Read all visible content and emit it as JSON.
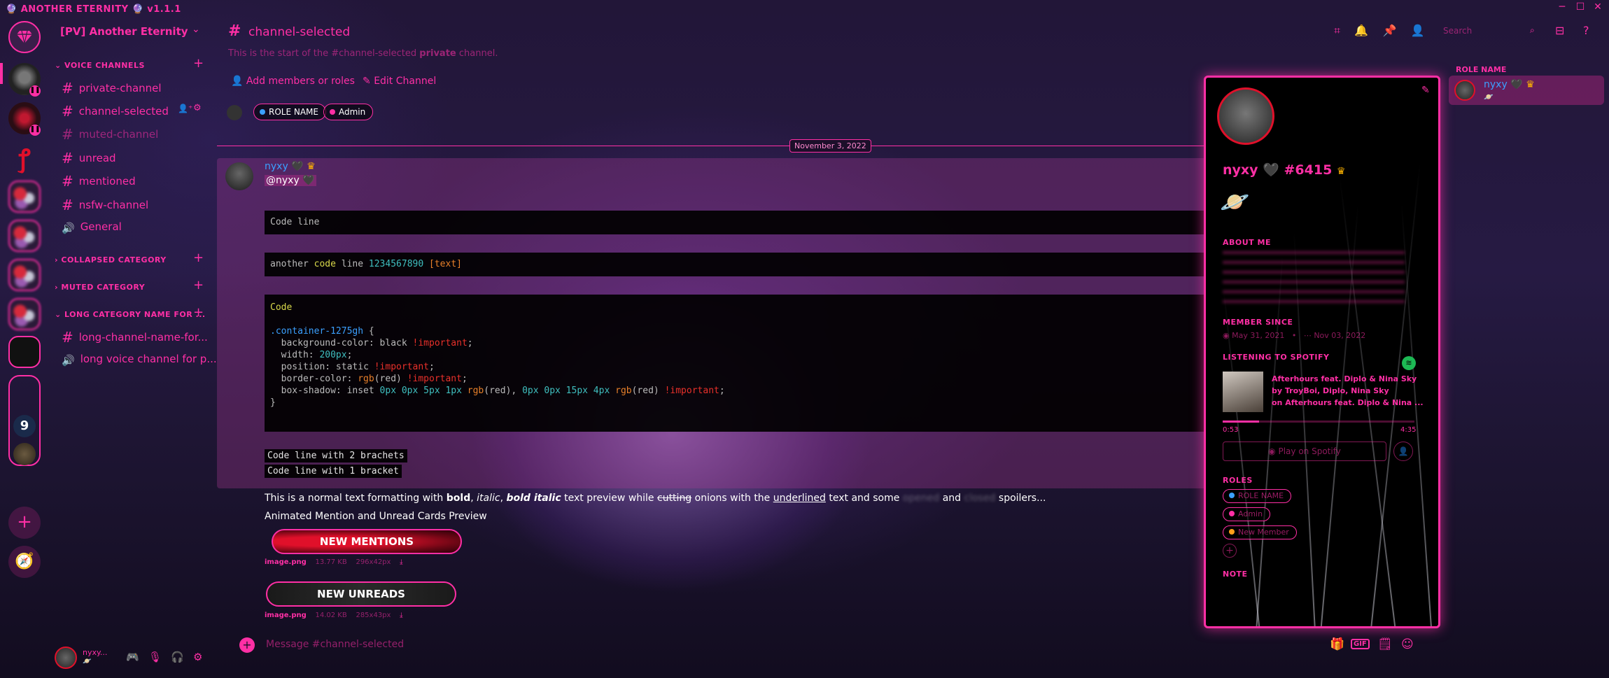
{
  "window": {
    "app_title": "ANOTHER ETERNITY",
    "version": "v1.1.1"
  },
  "server": {
    "name": "[PV] Another Eternity"
  },
  "sidebar": {
    "categories": [
      {
        "label": "VOICE CHANNELS"
      },
      {
        "label": "COLLAPSED CATEGORY"
      },
      {
        "label": "MUTED CATEGORY"
      },
      {
        "label": "LONG CATEGORY NAME FOR ..."
      }
    ],
    "channels": [
      {
        "label": "private-channel",
        "type": "text"
      },
      {
        "label": "channel-selected",
        "type": "text"
      },
      {
        "label": "muted-channel",
        "type": "text"
      },
      {
        "label": "unread",
        "type": "text"
      },
      {
        "label": "mentioned",
        "type": "text"
      },
      {
        "label": "nsfw-channel",
        "type": "text"
      },
      {
        "label": "General",
        "type": "voice"
      },
      {
        "label": "long-channel-name-for...",
        "type": "text"
      },
      {
        "label": "long voice channel for p...",
        "type": "voice"
      }
    ]
  },
  "header": {
    "channel_name": "channel-selected",
    "search_placeholder": "Search"
  },
  "intro": {
    "prefix": "This is the start of the",
    "channel": "#channel-selected",
    "private_word": "private",
    "suffix": "channel.",
    "add_members": "Add members or roles",
    "edit_channel": "Edit Channel",
    "roles": [
      {
        "label": "ROLE NAME",
        "color": "#3ba0ff"
      },
      {
        "label": "Admin",
        "color": "#ff2fa5"
      }
    ]
  },
  "date_divider": "November 3, 2022",
  "message": {
    "author": "nyxy",
    "mention": "@nyxy",
    "code_line": "Code line",
    "code_line_2": {
      "w1": "another",
      "w2": "code",
      "w3": "line",
      "num": "1234567890",
      "br": "[text]"
    },
    "code_block": {
      "lang": "Code",
      "l1_sel": ".container-1275gh",
      "l1_brace": " {",
      "l2_prop": "background-color:",
      "l2_val": " black ",
      "l2_imp": "!important",
      "l2_semi": ";",
      "l3_prop": "width:",
      "l3_val": " 200px",
      "l3_semi": ";",
      "l4_prop": "position:",
      "l4_val": " static ",
      "l4_imp": "!important",
      "l4_semi": ";",
      "l5_prop": "border-color:",
      "l5_fn": " rgb",
      "l5_arg": "(red) ",
      "l5_imp": "!important",
      "l5_semi": ";",
      "l6_prop": "box-shadow:",
      "l6_a": " inset ",
      "l6_b": "0px 0px 5px 1px ",
      "l6_c": "rgb",
      "l6_d": "(red), ",
      "l6_e": "0px 0px 15px 4px ",
      "l6_f": "rgb",
      "l6_g": "(red) ",
      "l6_h": "!important",
      "l6_semi": ";",
      "close": "}"
    },
    "inline_code_1": "Code line with 2 brachets",
    "inline_code_2": "Code line with 1 bracket",
    "text": {
      "t1": "This is a normal text formatting with ",
      "bold": "bold",
      "comma1": ", ",
      "italic": "italic",
      "comma2": ", ",
      "bold_italic": "bold italic",
      "t2": " text preview while ",
      "strike": "cutting",
      "t3": " onions with the ",
      "underline": "underlined",
      "t4": " text and some ",
      "spoiler1": "opened",
      "t5": " and ",
      "spoiler2": "closed",
      "t6": " spoilers..."
    },
    "preview_label": "Animated Mention and Unread Cards Preview",
    "attachments": [
      {
        "banner": "NEW MENTIONS",
        "name": "image.png",
        "size": "13.77 KB",
        "dims": "296x42px"
      },
      {
        "banner": "NEW UNREADS",
        "name": "image.png",
        "size": "14.02 KB",
        "dims": "285x43px"
      }
    ]
  },
  "composer": {
    "placeholder": "Message #channel-selected"
  },
  "user_panel": {
    "name": "nyxy..."
  },
  "profile": {
    "name": "nyxy",
    "discriminator": "#6415",
    "sections": {
      "about": "ABOUT ME",
      "member_since": "MEMBER SINCE",
      "spotify": "LISTENING TO SPOTIFY",
      "roles": "ROLES",
      "note": "NOTE"
    },
    "member_since_discord": "May 31, 2021",
    "member_since_server": "Nov 03, 2022",
    "spotify": {
      "track": "Afterhours feat. Diplo & Nina Sky",
      "artist": "by TroyBoi, Diplo, Nina Sky",
      "album": "on Afterhours feat. Diplo & Nina ...",
      "elapsed": "0:53",
      "duration": "4:35",
      "progress": 0.19,
      "play_label": "Play on Spotify"
    },
    "roles": [
      {
        "label": "ROLE NAME",
        "color": "#3ba0ff"
      },
      {
        "label": "Admin",
        "color": "#ff2fa5"
      },
      {
        "label": "New Member",
        "color": "#ff9f1a"
      }
    ]
  },
  "members": {
    "group_label": "ROLE NAME",
    "items": [
      {
        "name": "nyxy"
      }
    ]
  },
  "icons": {
    "server_home": "gem-icon",
    "threads": "threads-icon",
    "bell": "bell-icon",
    "pin": "pin-icon",
    "members": "members-icon",
    "inbox": "inbox-icon",
    "help": "help-icon"
  }
}
